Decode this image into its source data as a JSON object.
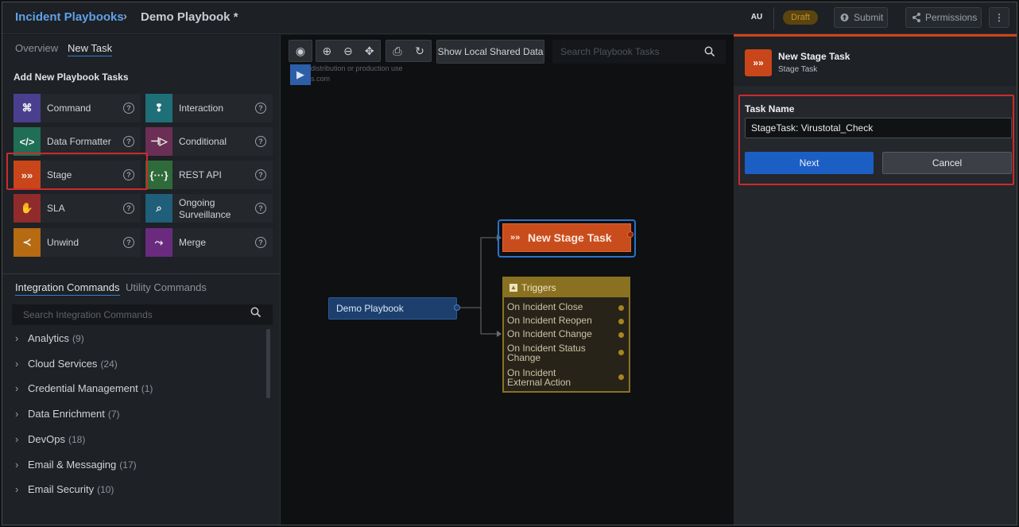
{
  "header": {
    "breadcrumb_root": "Incident Playbooks",
    "breadcrumb_sep": "›",
    "breadcrumb_current": "Demo Playbook *",
    "user_initials": "AU",
    "status_badge": "Draft",
    "submit_label": "Submit",
    "permissions_label": "Permissions",
    "more_icon": "⋮"
  },
  "left_panel": {
    "tabs": [
      "Overview",
      "New Task"
    ],
    "section_title": "Add New Playbook Tasks",
    "tasks": [
      {
        "label": "Command",
        "icon": "command-icon",
        "glyph": "⌘",
        "color": "#4a3f8f"
      },
      {
        "label": "Interaction",
        "icon": "interaction-icon",
        "glyph": "❢",
        "color": "#1f6f78"
      },
      {
        "label": "Data Formatter",
        "icon": "code-icon",
        "glyph": "</>",
        "color": "#1f6e55"
      },
      {
        "label": "Conditional",
        "icon": "conditional-icon",
        "glyph": "⊣▷",
        "color": "#6b2f55"
      },
      {
        "label": "Stage",
        "icon": "stage-icon",
        "glyph": "»»",
        "color": "#c9461a"
      },
      {
        "label": "REST API",
        "icon": "rest-api-icon",
        "glyph": "{···}",
        "color": "#2f6b3a"
      },
      {
        "label": "SLA",
        "icon": "handshake-icon",
        "glyph": "✋",
        "color": "#8f2b2b"
      },
      {
        "label": "Ongoing Surveillance",
        "icon": "surveillance-icon",
        "glyph": "⌕",
        "color": "#1f5f7a"
      },
      {
        "label": "Unwind",
        "icon": "unwind-icon",
        "glyph": "≺",
        "color": "#b66a12"
      },
      {
        "label": "Merge",
        "icon": "merge-icon",
        "glyph": "⤳",
        "color": "#6a2b7f"
      }
    ],
    "help_glyph": "?",
    "integration_tabs": [
      "Integration Commands",
      "Utility Commands"
    ],
    "search_placeholder": "Search Integration Commands",
    "categories": [
      {
        "name": "Analytics",
        "count": "(9)"
      },
      {
        "name": "Cloud Services",
        "count": "(24)"
      },
      {
        "name": "Credential Management",
        "count": "(1)"
      },
      {
        "name": "Data Enrichment",
        "count": "(7)"
      },
      {
        "name": "DevOps",
        "count": "(18)"
      },
      {
        "name": "Email & Messaging",
        "count": "(17)"
      },
      {
        "name": "Email Security",
        "count": "(10)"
      }
    ]
  },
  "canvas": {
    "local_data_label": "Show Local Shared Data",
    "search_placeholder": "Search Playbook Tasks",
    "watermark_line1": "distribution or production use",
    "watermark_line2": "s.com",
    "start_node": "Demo Playbook",
    "stage_node": "New Stage Task",
    "triggers_title": "Triggers",
    "triggers": [
      "On Incident Close",
      "On Incident Reopen",
      "On Incident Change",
      "On Incident Status Change",
      "On Incident External Action"
    ]
  },
  "right_panel": {
    "title": "New Stage Task",
    "subtitle": "Stage Task",
    "task_name_label": "Task Name",
    "task_name_value": "StageTask: Virustotal_Check",
    "next_label": "Next",
    "cancel_label": "Cancel"
  },
  "colors": {
    "accent": "#d4431a",
    "link": "#5fa0e8",
    "primary_button": "#1c5fc4",
    "highlight": "#cc2b2b"
  }
}
